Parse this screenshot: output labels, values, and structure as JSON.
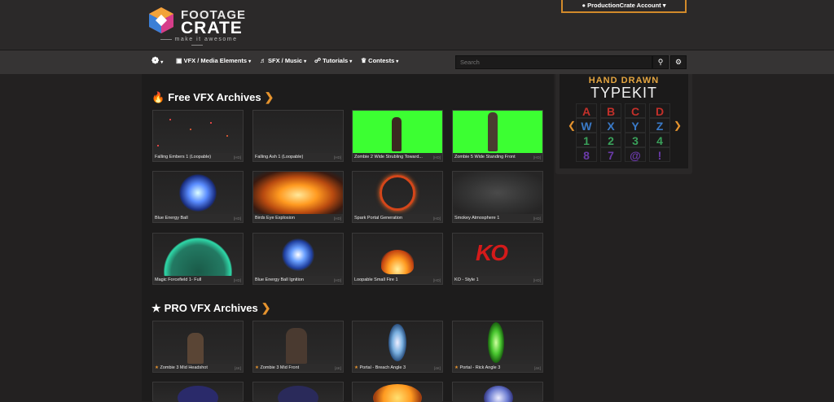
{
  "header": {
    "logo_line1": "FOOTAGE",
    "logo_line2": "CRATE",
    "logo_tagline": "make it awesome",
    "account_label": "ProductionCrate Account",
    "account_icon": "user-icon"
  },
  "nav": {
    "items": [
      {
        "label": "VFX / Media Elements",
        "icon": "video-icon"
      },
      {
        "label": "SFX / Music",
        "icon": "audio-icon"
      },
      {
        "label": "Tutorials",
        "icon": "book-icon"
      },
      {
        "label": "Contests",
        "icon": "trophy-icon"
      }
    ],
    "search_placeholder": "Search"
  },
  "free_section": {
    "title": "Free VFX Archives",
    "icon": "flame-icon",
    "items": [
      {
        "label": "Falling Embers 1 (Loopable)",
        "badge": "[HD]"
      },
      {
        "label": "Falling Ash 1 (Loopable)",
        "badge": "[HD]"
      },
      {
        "label": "Zombie 2 Wide Strubling Toward...",
        "badge": "[HD]"
      },
      {
        "label": "Zombie 5 Wide Standing Front",
        "badge": "[HD]"
      },
      {
        "label": "Blue Energy Ball",
        "badge": "[HD]"
      },
      {
        "label": "Birds Eye Explosion",
        "badge": "[HD]"
      },
      {
        "label": "Spark Portal Generation",
        "badge": "[HD]"
      },
      {
        "label": "Smokey Atmosphere 1",
        "badge": "[HD]"
      },
      {
        "label": "Magic Forcefield 1- Full",
        "badge": "[HD]"
      },
      {
        "label": "Blue Energy Ball Ignition",
        "badge": "[HD]"
      },
      {
        "label": "Loopable Small Fire 1",
        "badge": "[HD]"
      },
      {
        "label": "KO - Style 1",
        "badge": "[HD]"
      }
    ]
  },
  "pro_section": {
    "title": "PRO VFX Archives",
    "icon": "star-icon",
    "items": [
      {
        "label": "Zombie 3 Mid Headshot",
        "badge": "[4K]"
      },
      {
        "label": "Zombie 3 Mid Front",
        "badge": "[4K]"
      },
      {
        "label": "Portal - Breach Angle 3",
        "badge": "[4K]"
      },
      {
        "label": "Portal - Rick Angle 3",
        "badge": "[4K]"
      }
    ]
  },
  "ad": {
    "line1": "HAND DRAWN",
    "line2": "TYPEKIT",
    "letters": [
      "A",
      "B",
      "C",
      "D",
      "W",
      "X",
      "Y",
      "Z",
      "1",
      "2",
      "3",
      "4",
      "8",
      "7",
      "@",
      "!"
    ]
  },
  "colors": {
    "accent": "#e5932e",
    "greenscreen": "#3cff32",
    "background": "#232121"
  }
}
